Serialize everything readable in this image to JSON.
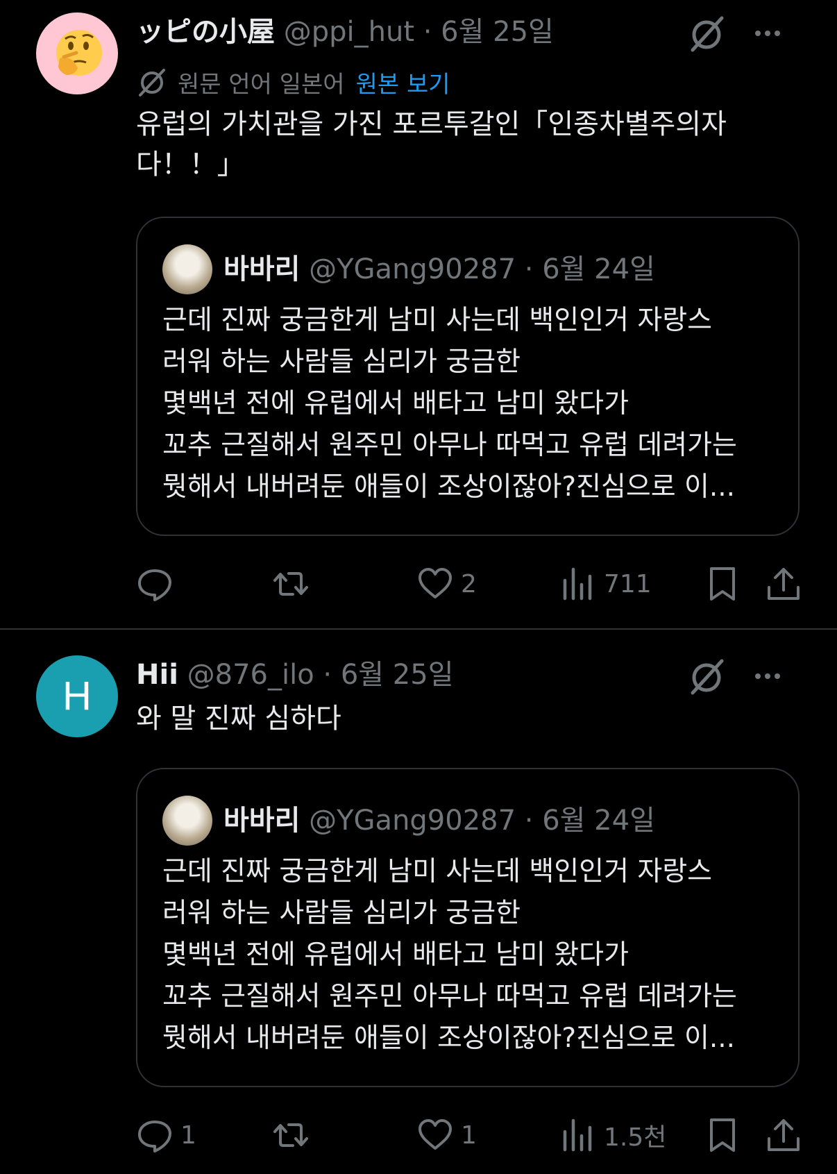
{
  "tweets": [
    {
      "author": {
        "name": "ッピの小屋",
        "handle": "@ppi_hut"
      },
      "separator": "·",
      "date": "6월 25일",
      "translation": {
        "source_text": "원문 언어 일본어",
        "link_label": "원본 보기"
      },
      "text": "유럽의 가치관을 가진 포르투갈인「인종차별주의자다！！」",
      "quote": {
        "author": {
          "name": "바바리",
          "handle": "@YGang90287"
        },
        "separator": "·",
        "date": "6월 24일",
        "lines": [
          "근데 진짜 궁금한게 남미 사는데 백인인거  자랑스",
          "러워 하는 사람들 심리가 궁금한",
          "몇백년 전에 유럽에서 배타고 남미 왔다가",
          "꼬추 근질해서 원주민 아무나 따먹고 유럽 데려가는",
          "뭣해서 내버려둔 애들이 조상이잖아?진심으로 이..."
        ]
      },
      "actions": {
        "replies": "",
        "retweets": "",
        "likes": "2",
        "views": "711"
      }
    },
    {
      "author": {
        "name": "Hii",
        "handle": "@876_ilo",
        "avatar_letter": "H"
      },
      "separator": "·",
      "date": "6월 25일",
      "text": "와 말 진짜 심하다",
      "quote": {
        "author": {
          "name": "바바리",
          "handle": "@YGang90287"
        },
        "separator": "·",
        "date": "6월 24일",
        "lines": [
          "근데 진짜 궁금한게 남미 사는데 백인인거  자랑스",
          "러워 하는 사람들 심리가 궁금한",
          "몇백년 전에 유럽에서 배타고 남미 왔다가",
          "꼬추 근질해서 원주민 아무나 따먹고 유럽 데려가는",
          "뭣해서 내버려둔 애들이 조상이잖아?진심으로 이..."
        ]
      },
      "actions": {
        "replies": "1",
        "retweets": "",
        "likes": "1",
        "views": "1.5천"
      }
    }
  ],
  "icons": {
    "grok": "grok-icon",
    "more": "more-icon",
    "reply": "reply-icon",
    "retweet": "retweet-icon",
    "like": "heart-icon",
    "views": "views-icon",
    "bookmark": "bookmark-icon",
    "share": "share-icon"
  },
  "colors": {
    "background": "#000000",
    "text": "#e7e9ea",
    "muted": "#71767b",
    "link": "#1d9bf0",
    "border": "#2f3336"
  }
}
